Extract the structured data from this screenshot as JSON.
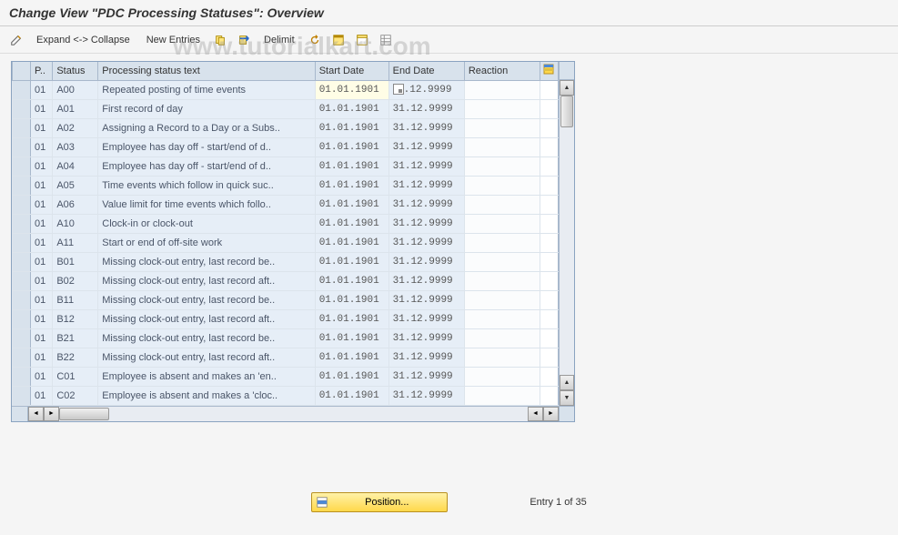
{
  "header": {
    "title": "Change View \"PDC Processing Statuses\": Overview"
  },
  "toolbar": {
    "expand_collapse": "Expand <-> Collapse",
    "new_entries": "New Entries",
    "delimit": "Delimit"
  },
  "columns": {
    "p": "P..",
    "status": "Status",
    "text": "Processing status text",
    "start": "Start Date",
    "end": "End Date",
    "reaction": "Reaction"
  },
  "rows": [
    {
      "p": "01",
      "status": "A00",
      "text": "Repeated posting of time events",
      "start": "01.01.1901",
      "end": ".12.9999",
      "reaction": "",
      "hl": true,
      "f4": true
    },
    {
      "p": "01",
      "status": "A01",
      "text": "First record of day",
      "start": "01.01.1901",
      "end": "31.12.9999",
      "reaction": ""
    },
    {
      "p": "01",
      "status": "A02",
      "text": "Assigning a Record to a Day or a Subs..",
      "start": "01.01.1901",
      "end": "31.12.9999",
      "reaction": ""
    },
    {
      "p": "01",
      "status": "A03",
      "text": "Employee has day off - start/end of d..",
      "start": "01.01.1901",
      "end": "31.12.9999",
      "reaction": ""
    },
    {
      "p": "01",
      "status": "A04",
      "text": "Employee has day off - start/end of d..",
      "start": "01.01.1901",
      "end": "31.12.9999",
      "reaction": ""
    },
    {
      "p": "01",
      "status": "A05",
      "text": "Time events which follow in quick suc..",
      "start": "01.01.1901",
      "end": "31.12.9999",
      "reaction": ""
    },
    {
      "p": "01",
      "status": "A06",
      "text": "Value limit for time events which follo..",
      "start": "01.01.1901",
      "end": "31.12.9999",
      "reaction": ""
    },
    {
      "p": "01",
      "status": "A10",
      "text": "Clock-in or clock-out",
      "start": "01.01.1901",
      "end": "31.12.9999",
      "reaction": ""
    },
    {
      "p": "01",
      "status": "A11",
      "text": "Start or end of off-site work",
      "start": "01.01.1901",
      "end": "31.12.9999",
      "reaction": ""
    },
    {
      "p": "01",
      "status": "B01",
      "text": "Missing clock-out entry, last record be..",
      "start": "01.01.1901",
      "end": "31.12.9999",
      "reaction": ""
    },
    {
      "p": "01",
      "status": "B02",
      "text": "Missing clock-out entry, last record aft..",
      "start": "01.01.1901",
      "end": "31.12.9999",
      "reaction": ""
    },
    {
      "p": "01",
      "status": "B11",
      "text": "Missing clock-out entry, last record be..",
      "start": "01.01.1901",
      "end": "31.12.9999",
      "reaction": ""
    },
    {
      "p": "01",
      "status": "B12",
      "text": "Missing clock-out entry, last record aft..",
      "start": "01.01.1901",
      "end": "31.12.9999",
      "reaction": ""
    },
    {
      "p": "01",
      "status": "B21",
      "text": "Missing clock-out entry, last record be..",
      "start": "01.01.1901",
      "end": "31.12.9999",
      "reaction": ""
    },
    {
      "p": "01",
      "status": "B22",
      "text": "Missing clock-out entry, last record aft..",
      "start": "01.01.1901",
      "end": "31.12.9999",
      "reaction": ""
    },
    {
      "p": "01",
      "status": "C01",
      "text": "Employee is absent and makes an 'en..",
      "start": "01.01.1901",
      "end": "31.12.9999",
      "reaction": ""
    },
    {
      "p": "01",
      "status": "C02",
      "text": "Employee is absent and makes a 'cloc..",
      "start": "01.01.1901",
      "end": "31.12.9999",
      "reaction": ""
    }
  ],
  "footer": {
    "position": "Position...",
    "entry": "Entry 1 of 35"
  },
  "watermark": "www.tutorialkart.com"
}
